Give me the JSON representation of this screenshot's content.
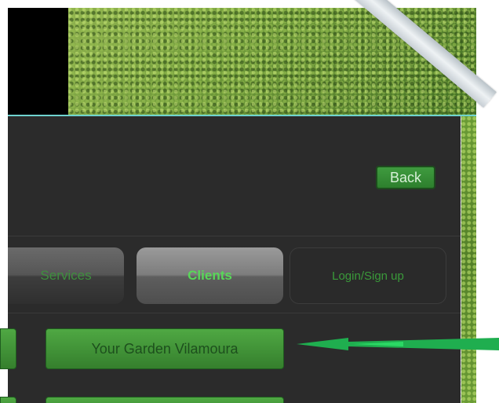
{
  "header": {
    "back_label": "Back"
  },
  "tabs": [
    {
      "label": "Services"
    },
    {
      "label": "Clients"
    },
    {
      "label": "Login/Sign up"
    }
  ],
  "clients": [
    {
      "label": "Your Garden Vilamoura"
    },
    {
      "label": ""
    }
  ],
  "colors": {
    "panel": "#2b2b2b",
    "accent_green": "#3f9b3f",
    "teal_line": "#6fd3cf",
    "arrow": "#1fae4f"
  },
  "icons": {
    "annotation": "arrow-left-icon"
  }
}
